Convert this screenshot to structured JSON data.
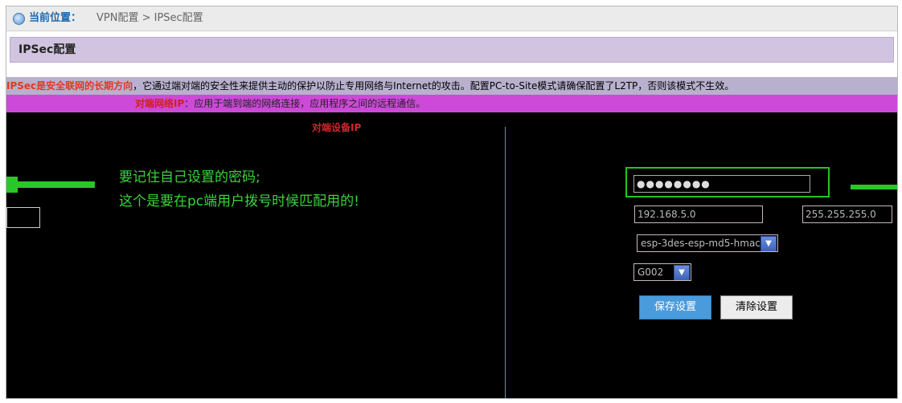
{
  "breadcrumb": {
    "icon": "globe-icon",
    "label": "当前位置：",
    "path": "VPN配置 > IPSec配置"
  },
  "section": {
    "title": "IPSec配置"
  },
  "banner": {
    "line1_red": "IPSec是安全联网的长期方向",
    "line1_text": "，它通过端对端的安全性来提供主动的保护以防止专用网络与Internet的攻击。配置PC-to-Site模式请确保配置了L2TP，否则该模式不生效。",
    "line2_red": "对端网络IP",
    "line2_text": "：应用于端到端的网络连接，应用程序之间的远程通信。"
  },
  "form": {
    "peer_device_label": "对端设备IP",
    "psk_value": "●●●●●●●●",
    "ip_value": "192.168.5.0",
    "mask_value": "255.255.255.0",
    "encryption_value": "esp-3des-esp-md5-hmac",
    "dh_group_value": "G002",
    "save_label": "保存设置",
    "clear_label": "清除设置"
  },
  "annotation": {
    "line1": "要记住自己设置的密码;",
    "line2": "这个是要在pc端用户拨号时候匹配用的!",
    "color": "#39d43b"
  },
  "colors": {
    "section_bg": "#d1c4e0",
    "banner_magenta": "#cd4ad9",
    "save_button": "#4a9bdc",
    "highlight_green": "#22c522"
  }
}
